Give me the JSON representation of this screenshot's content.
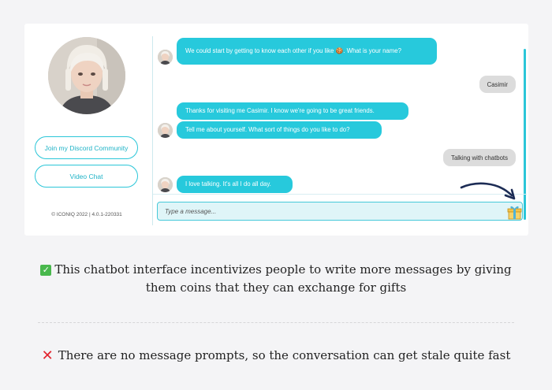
{
  "sidebar": {
    "discord_label": "Join my Discord Community",
    "video_label": "Video Chat",
    "copyright": "© ICONIQ 2022 | 4.0.1-220331"
  },
  "chat": {
    "messages": [
      {
        "from": "bot",
        "text": "We could start by getting to know each other if you like 🍪. What is your name?"
      },
      {
        "from": "user",
        "text": "Casimir"
      },
      {
        "from": "bot",
        "text": "Thanks for visiting me Casimir. I know we're going to be great friends."
      },
      {
        "from": "bot",
        "text": "Tell me about yourself. What sort of things do you like to do?"
      },
      {
        "from": "user",
        "text": "Talking with chatbots"
      },
      {
        "from": "bot",
        "text": "I love talking. It's all I do all day."
      }
    ],
    "input_placeholder": "Type a message..."
  },
  "captions": {
    "pro_text": "This chatbot interface incentivizes people to write more messages by giving them coins that they can exchange for gifts",
    "con_text": "There are no message prompts, so the conversation can get stale quite fast"
  },
  "colors": {
    "accent": "#27c9dc",
    "user_bubble": "#dcdcdc",
    "check": "#49b84d",
    "cross": "#e2232e"
  }
}
